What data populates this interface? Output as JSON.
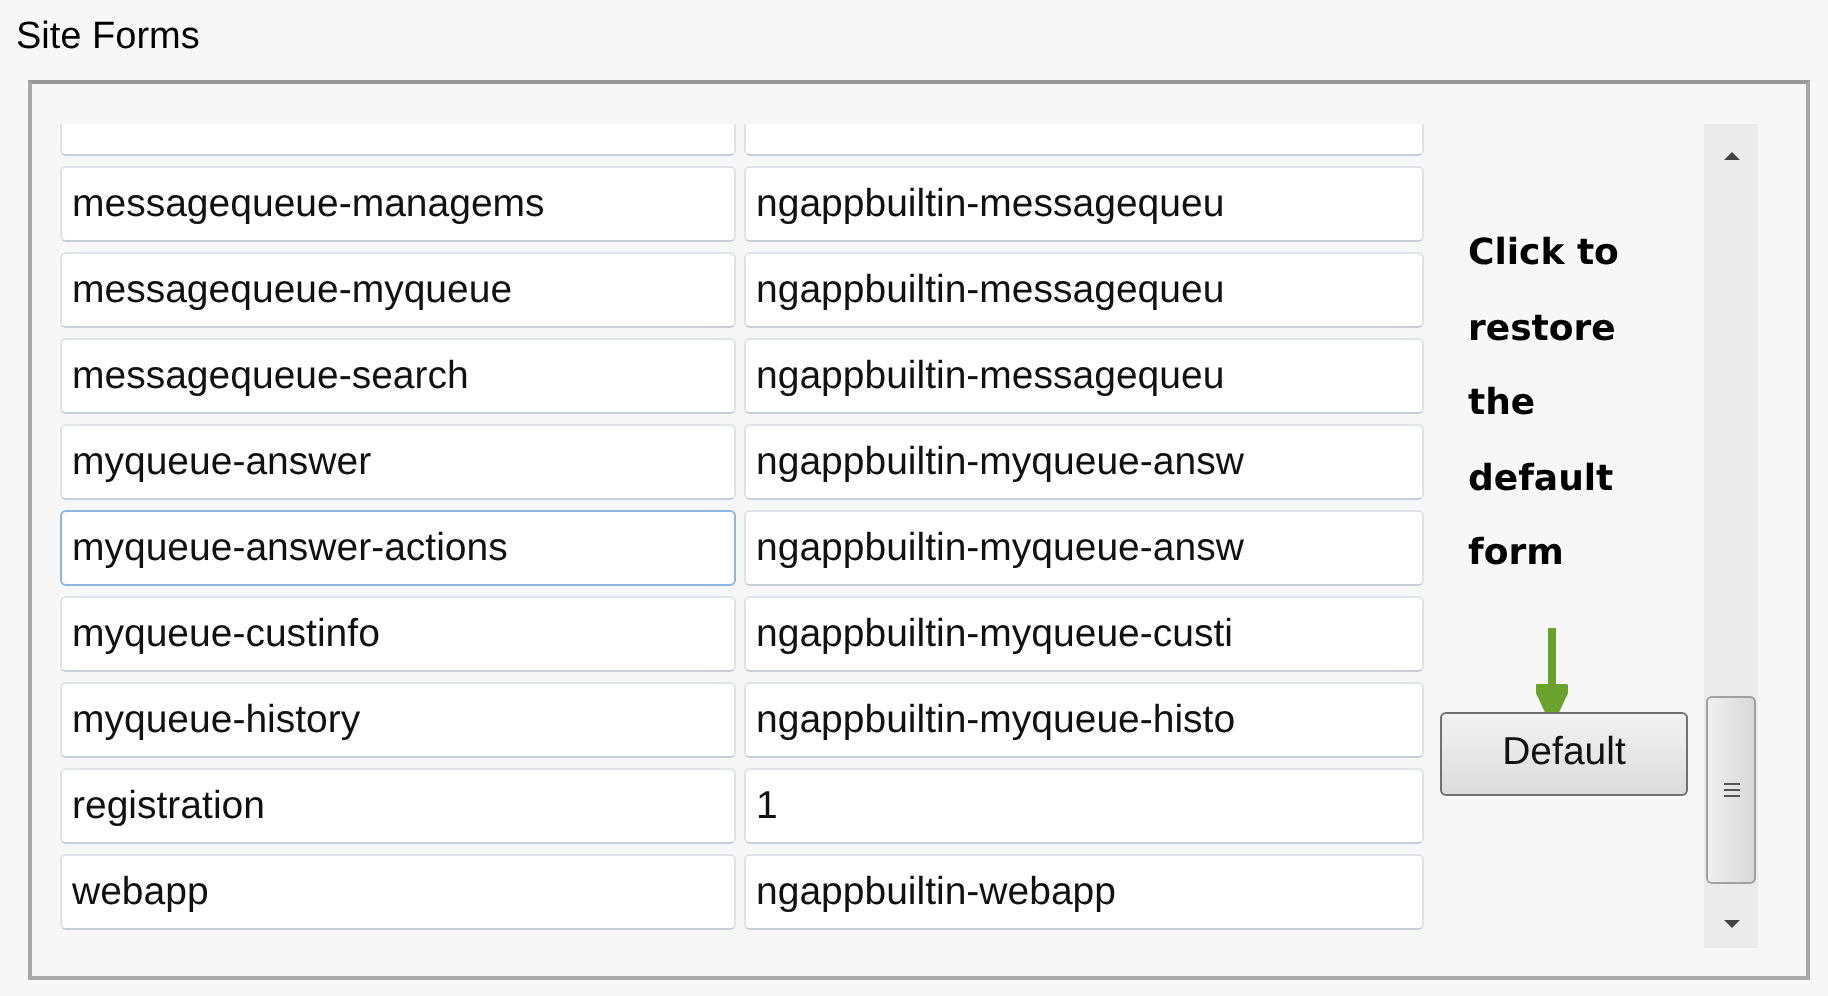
{
  "title": "Site Forms",
  "rows": [
    {
      "name": "messagequeue-managems",
      "value": "ngappbuiltin-messagequeu",
      "focused": false
    },
    {
      "name": "messagequeue-myqueue",
      "value": "ngappbuiltin-messagequeu",
      "focused": false
    },
    {
      "name": "messagequeue-search",
      "value": "ngappbuiltin-messagequeu",
      "focused": false
    },
    {
      "name": "myqueue-answer",
      "value": "ngappbuiltin-myqueue-answ",
      "focused": false
    },
    {
      "name": "myqueue-answer-actions",
      "value": "ngappbuiltin-myqueue-answ",
      "focused": true
    },
    {
      "name": "myqueue-custinfo",
      "value": "ngappbuiltin-myqueue-custi",
      "focused": false
    },
    {
      "name": "myqueue-history",
      "value": "ngappbuiltin-myqueue-histo",
      "focused": false
    },
    {
      "name": "registration",
      "value": "1",
      "focused": false
    },
    {
      "name": "webapp",
      "value": "ngappbuiltin-webapp",
      "focused": false
    }
  ],
  "callout": {
    "lines": [
      "Click to",
      "restore",
      "the",
      "default",
      "form"
    ]
  },
  "button": "Default"
}
